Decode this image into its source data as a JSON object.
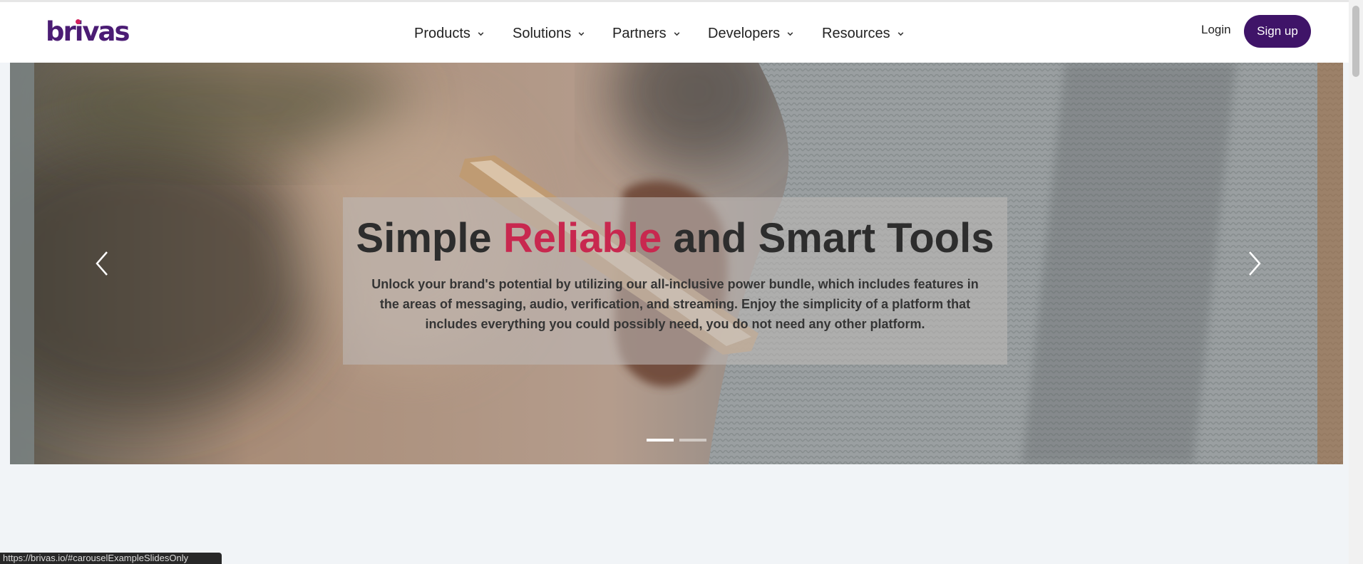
{
  "brand": {
    "name": "brivas"
  },
  "nav": {
    "items": [
      {
        "label": "Products",
        "icon": "chevron-down-icon"
      },
      {
        "label": "Solutions",
        "icon": "chevron-down-icon"
      },
      {
        "label": "Partners",
        "icon": "chevron-down-icon"
      },
      {
        "label": "Developers",
        "icon": "chevron-down-icon"
      },
      {
        "label": "Resources",
        "icon": "chevron-down-icon"
      }
    ],
    "login_label": "Login",
    "signup_label": "Sign up"
  },
  "hero": {
    "headline_start": "Simple",
    "headline_accent": "Reliable",
    "headline_end": "and Smart Tools",
    "subtext": "Unlock your brand's potential by utilizing our all-inclusive power bundle, which includes features in the areas of messaging, audio, verification, and streaming. Enjoy the simplicity of a platform that includes everything you could possibly need, you do not need any other platform.",
    "slide_count": 2,
    "active_slide": 1
  },
  "status_url": "https://brivas.io/#carouselExampleSlidesOnly",
  "colors": {
    "brand_purple": "#3f1468",
    "accent_red": "#c8284f",
    "logo_dot": "#d21f5c"
  }
}
